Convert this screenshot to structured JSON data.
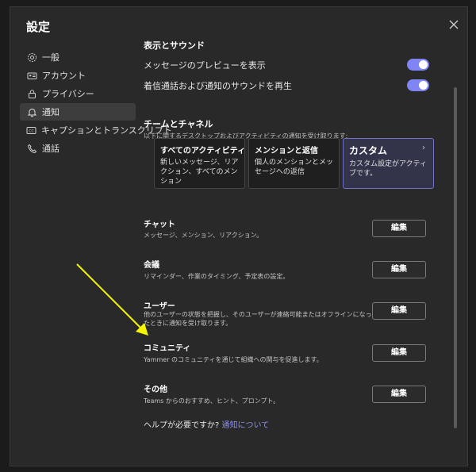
{
  "dialog": {
    "title": "設定"
  },
  "nav": {
    "items": [
      {
        "label": "一般"
      },
      {
        "label": "アカウント"
      },
      {
        "label": "プライバシー"
      },
      {
        "label": "通知"
      },
      {
        "label": "キャプションとトランスクリプト"
      },
      {
        "label": "通話"
      }
    ],
    "active_index": 3
  },
  "display_sound": {
    "title": "表示とサウンド",
    "rows": [
      {
        "label": "メッセージのプレビューを表示",
        "on": true
      },
      {
        "label": "着信通話および通知のサウンドを再生",
        "on": true
      }
    ]
  },
  "teams_channels": {
    "title": "チームとチャネル",
    "subtitle": "以下に関するデスクトップおよびアクティビティの通知を受け取ります:",
    "cards": [
      {
        "title": "すべてのアクティビティ",
        "desc": "新しいメッセージ、リアクション、すべてのメンション"
      },
      {
        "title": "メンションと返信",
        "desc": "個人のメンションとメッセージへの返信"
      },
      {
        "title": "カスタム",
        "desc": "カスタム設定がアクティブです。",
        "selected": true,
        "chevron": "›"
      }
    ]
  },
  "notifications": [
    {
      "title": "チャット",
      "desc": "メッセージ、メンション、リアクション。",
      "button": "編集"
    },
    {
      "title": "会議",
      "desc": "リマインダー、作業のタイミング、予定表の設定。",
      "button": "編集"
    },
    {
      "title": "ユーザー",
      "desc": "他のユーザーの状態を把握し、そのユーザーが連絡可能またはオフラインになったときに通知を受け取ります。",
      "button": "編集"
    },
    {
      "title": "コミュニティ",
      "desc": "Yammer のコミュニティを通じて組織への関与を促進します。",
      "button": "編集"
    },
    {
      "title": "その他",
      "desc": "Teams からのおすすめ、ヒント、プロンプト。",
      "button": "編集"
    }
  ],
  "help": {
    "text": "ヘルプが必要ですか?",
    "link": "通知について"
  },
  "colors": {
    "accent": "#7f85f5",
    "annotation_arrow": "#f5f500"
  }
}
